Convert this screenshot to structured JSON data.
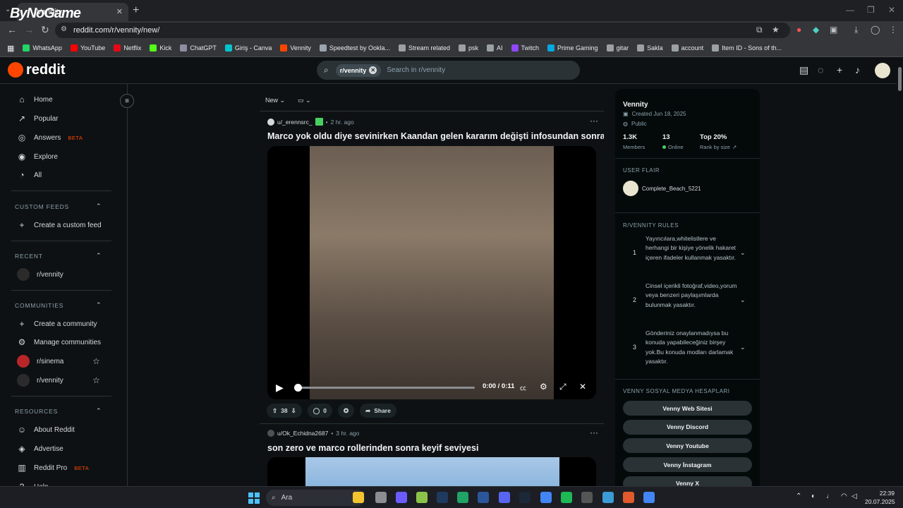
{
  "browser": {
    "tab_title": "Vennity",
    "overlay_logo": "ByNoGame",
    "url": "reddit.com/r/vennity/new/",
    "bookmarks": [
      {
        "label": "WhatsApp",
        "color": "#25d366"
      },
      {
        "label": "YouTube",
        "color": "#ff0000"
      },
      {
        "label": "Netflix",
        "color": "#e50914"
      },
      {
        "label": "Kick",
        "color": "#53fc18"
      },
      {
        "label": "ChatGPT",
        "color": "#8e8ea0"
      },
      {
        "label": "Giriş - Canva",
        "color": "#00c4cc"
      },
      {
        "label": "Vennity",
        "color": "#ff4500"
      },
      {
        "label": "Speedtest by Ookla...",
        "color": "#9ca3af"
      },
      {
        "label": "Stream related",
        "color": "#9aa0a6"
      },
      {
        "label": "psk",
        "color": "#9aa0a6"
      },
      {
        "label": "AI",
        "color": "#9aa0a6"
      },
      {
        "label": "Twitch",
        "color": "#9146ff"
      },
      {
        "label": "Prime Gaming",
        "color": "#00a8e1"
      },
      {
        "label": "gitar",
        "color": "#9aa0a6"
      },
      {
        "label": "Sakla",
        "color": "#9aa0a6"
      },
      {
        "label": "account",
        "color": "#9aa0a6"
      },
      {
        "label": "Item ID - Sons of th...",
        "color": "#9aa0a6"
      }
    ]
  },
  "header": {
    "logo_text": "reddit",
    "search_chip": "r/vennity",
    "search_placeholder": "Search in r/vennity"
  },
  "sidebar": {
    "main": [
      {
        "label": "Home",
        "icon": "home-icon",
        "glyph": "⌂"
      },
      {
        "label": "Popular",
        "icon": "popular-icon",
        "glyph": "↗"
      },
      {
        "label": "Answers",
        "icon": "answers-icon",
        "glyph": "◎",
        "badge": "BETA"
      },
      {
        "label": "Explore",
        "icon": "explore-icon",
        "glyph": "◉"
      },
      {
        "label": "All",
        "icon": "all-icon",
        "glyph": "◔"
      }
    ],
    "custom_feeds_title": "CUSTOM FEEDS",
    "create_custom_feed": "Create a custom feed",
    "recent_title": "RECENT",
    "recent": [
      {
        "label": "r/vennity"
      }
    ],
    "communities_title": "COMMUNITIES",
    "create_community": "Create a community",
    "manage_communities": "Manage communities",
    "communities": [
      {
        "label": "r/sinema",
        "color": "#b8262a"
      },
      {
        "label": "r/vennity",
        "color": "#2b2b2b"
      }
    ],
    "resources_title": "RESOURCES",
    "resources": [
      {
        "label": "About Reddit",
        "glyph": "☺"
      },
      {
        "label": "Advertise",
        "glyph": "◈"
      },
      {
        "label": "Reddit Pro",
        "glyph": "▥",
        "badge": "BETA"
      },
      {
        "label": "Help",
        "glyph": "?"
      }
    ]
  },
  "feed": {
    "sort_label": "New",
    "posts": [
      {
        "author": "u/_erennsrc_",
        "age": "2 hr. ago",
        "title": "Marco yok oldu diye sevinirken Kaandan gelen kararım değişti infosundan sonra biz",
        "video_time": "0:00 / 0:11",
        "progress": 0.0,
        "votes": "38",
        "comments": "0",
        "share": "Share"
      },
      {
        "author": "u/Ok_Echidna2687",
        "age": "3 hr. ago",
        "title": "son zero ve marco rollerinden sonra keyif seviyesi"
      }
    ]
  },
  "right": {
    "name": "Vennity",
    "created": "Created Jun 18, 2025",
    "visibility": "Public",
    "members_value": "1.3K",
    "members_label": "Members",
    "online_value": "13",
    "online_label": "Online",
    "rank_value": "Top 20%",
    "rank_label": "Rank by size",
    "user_flair_title": "USER FLAIR",
    "flair_name": "Complete_Beach_5221",
    "rules_title": "R/VENNITY RULES",
    "rules": [
      {
        "n": "1",
        "text": "Yayıncılara,whitelistlere ve herhangi bir kişiye yönelik hakaret içeren ifadeler kullanmak yasaktır."
      },
      {
        "n": "2",
        "text": "Cinsel içerikli fotoğraf,video,yorum veya benzeri paylaşımlarda bulunmak yasaktır."
      },
      {
        "n": "3",
        "text": "Gönderiniz onaylanmadıysa bu konuda yapabileceğiniz birşey yok.Bu konuda modları darlamak yasaktır."
      }
    ],
    "social_title": "VENNY SOSYAL MEDYA HESAPLARI",
    "social": [
      "Venny Web Sitesi",
      "Venny Discord",
      "Venny Youtube",
      "Venny İnstagram",
      "Venny X"
    ]
  },
  "taskbar": {
    "search": "Ara",
    "time": "22:39",
    "date": "20.07.2025"
  }
}
